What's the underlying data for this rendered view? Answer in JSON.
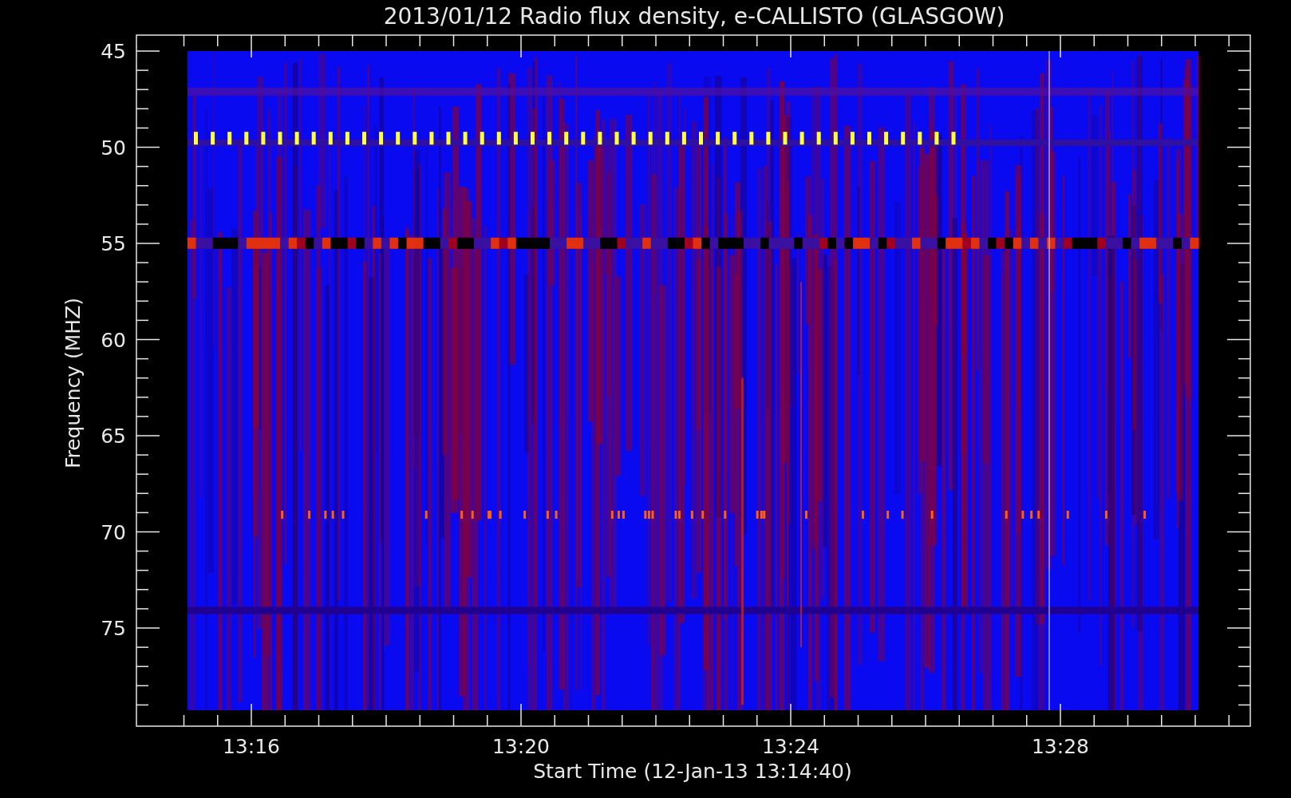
{
  "title": "2013/01/12  Radio flux density, e-CALLISTO (GLASGOW)",
  "y_axis": {
    "label": "Frequency (MHZ)",
    "ticks": [
      "45",
      "50",
      "55",
      "60",
      "65",
      "70",
      "75"
    ]
  },
  "x_axis": {
    "label": "Start Time (12-Jan-13 13:14:40)",
    "ticks": [
      "13:16",
      "13:20",
      "13:24",
      "13:28"
    ]
  }
}
